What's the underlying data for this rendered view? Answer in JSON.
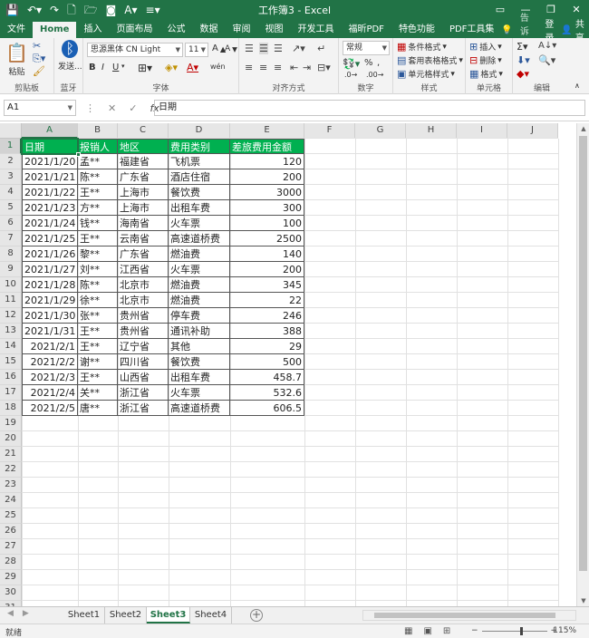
{
  "window": {
    "title": "工作簿3 - Excel",
    "quick_access": [
      "save-icon",
      "undo-icon",
      "redo-icon",
      "new-file-icon",
      "open-icon",
      "camera-icon",
      "font-color-icon",
      "customize-icon"
    ],
    "controls": [
      "ribbon-display-icon",
      "minimize-icon",
      "restore-icon",
      "close-icon"
    ]
  },
  "ribbon_tabs": [
    {
      "label": "文件",
      "active": false
    },
    {
      "label": "Home",
      "active": true
    },
    {
      "label": "插入",
      "active": false
    },
    {
      "label": "页面布局",
      "active": false
    },
    {
      "label": "公式",
      "active": false
    },
    {
      "label": "数据",
      "active": false
    },
    {
      "label": "审阅",
      "active": false
    },
    {
      "label": "视图",
      "active": false
    },
    {
      "label": "开发工具",
      "active": false
    },
    {
      "label": "福昕PDF",
      "active": false
    },
    {
      "label": "特色功能",
      "active": false
    },
    {
      "label": "PDF工具集",
      "active": false
    }
  ],
  "tab_right": {
    "tell_me": "告诉我...",
    "login": "登录",
    "share": "共享"
  },
  "ribbon": {
    "clipboard": {
      "label": "剪贴板",
      "paste": "粘贴"
    },
    "bluetooth": {
      "label": "蓝牙",
      "send": "发送..."
    },
    "font": {
      "label": "字体",
      "font_name": "思源黑体 CN Light",
      "font_size": "11",
      "bold": "B",
      "italic": "I",
      "underline": "U",
      "grow": "A",
      "shrink": "A",
      "wen": "wén"
    },
    "alignment": {
      "label": "对齐方式"
    },
    "number": {
      "label": "数字",
      "format": "常规",
      "percent": "%",
      "comma": ","
    },
    "styles": {
      "label": "样式",
      "conditional": "条件格式",
      "table_format": "套用表格格式",
      "cell_styles": "单元格样式"
    },
    "cells": {
      "label": "单元格",
      "insert": "插入",
      "delete": "删除",
      "format": "格式"
    },
    "editing": {
      "label": "编辑"
    }
  },
  "formula_bar": {
    "name_box": "A1",
    "cancel": "✕",
    "enter": "✓",
    "fx": "fx",
    "content": "日期"
  },
  "columns": [
    "A",
    "B",
    "C",
    "D",
    "E",
    "F",
    "G",
    "H",
    "I",
    "J"
  ],
  "row_count": 31,
  "table": {
    "headers": [
      "日期",
      "报销人",
      "地区",
      "费用类别",
      "差旅费用金额"
    ],
    "rows": [
      [
        "2021/1/20",
        "孟**",
        "福建省",
        "飞机票",
        "120"
      ],
      [
        "2021/1/21",
        "陈**",
        "广东省",
        "酒店住宿",
        "200"
      ],
      [
        "2021/1/22",
        "王**",
        "上海市",
        "餐饮费",
        "3000"
      ],
      [
        "2021/1/23",
        "方**",
        "上海市",
        "出租车费",
        "300"
      ],
      [
        "2021/1/24",
        "钱**",
        "海南省",
        "火车票",
        "100"
      ],
      [
        "2021/1/25",
        "王**",
        "云南省",
        "高速道桥费",
        "2500"
      ],
      [
        "2021/1/26",
        "黎**",
        "广东省",
        "燃油费",
        "140"
      ],
      [
        "2021/1/27",
        "刘**",
        "江西省",
        "火车票",
        "200"
      ],
      [
        "2021/1/28",
        "陈**",
        "北京市",
        "燃油费",
        "345"
      ],
      [
        "2021/1/29",
        "徐**",
        "北京市",
        "燃油费",
        "22"
      ],
      [
        "2021/1/30",
        "张**",
        "贵州省",
        "停车费",
        "246"
      ],
      [
        "2021/1/31",
        "王**",
        "贵州省",
        "通讯补助",
        "388"
      ],
      [
        "2021/2/1",
        "王**",
        "辽宁省",
        "其他",
        "29"
      ],
      [
        "2021/2/2",
        "谢**",
        "四川省",
        "餐饮费",
        "500"
      ],
      [
        "2021/2/3",
        "王**",
        "山西省",
        "出租车费",
        "458.7"
      ],
      [
        "2021/2/4",
        "关**",
        "浙江省",
        "火车票",
        "532.6"
      ],
      [
        "2021/2/5",
        "唐**",
        "浙江省",
        "高速道桥费",
        "606.5"
      ]
    ]
  },
  "sheets": [
    {
      "label": "Sheet1",
      "active": false
    },
    {
      "label": "Sheet2",
      "active": false
    },
    {
      "label": "Sheet3",
      "active": true
    },
    {
      "label": "Sheet4",
      "active": false
    }
  ],
  "status": {
    "ready": "就绪",
    "zoom": "115%",
    "minus": "−",
    "plus": "+"
  },
  "colors": {
    "excel_green": "#217346",
    "header_fill": "#00b050"
  }
}
